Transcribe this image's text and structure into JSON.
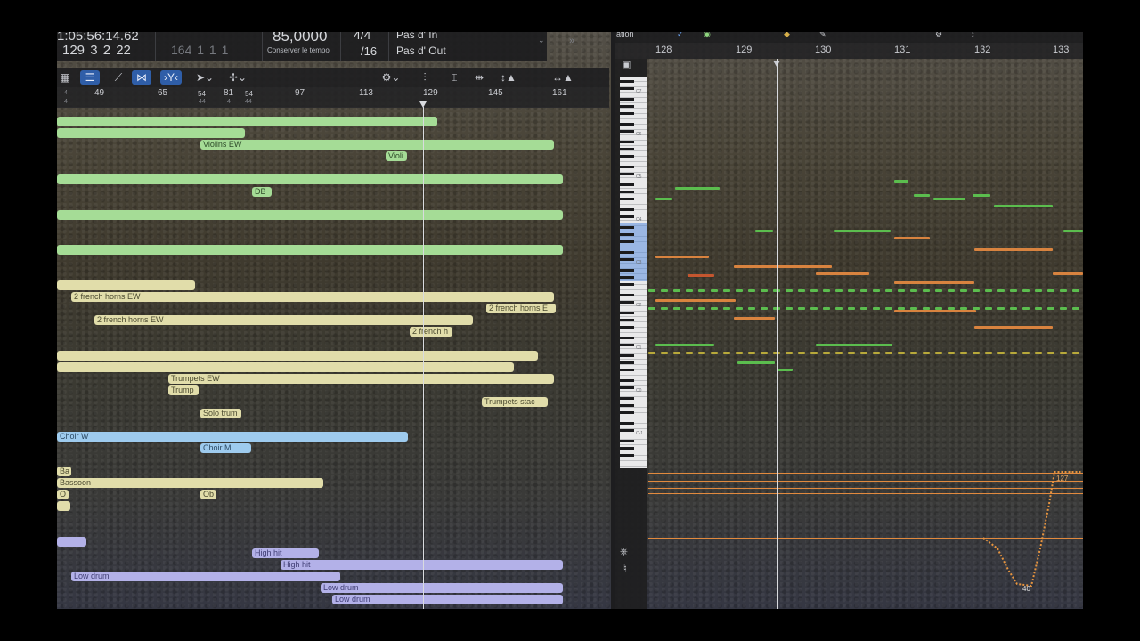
{
  "transport": {
    "time": "1:05:56:14.62",
    "position": "129  3  2    22",
    "end_position": "164  1  1    1",
    "tempo": "85,0000",
    "tempo_label": "Conserver le tempo",
    "signature": "4/4",
    "division": "/16",
    "punch_in": "Pas d' In",
    "punch_out": "Pas d' Out",
    "chevron": "»"
  },
  "left_ruler": {
    "bars": [
      "49",
      "65",
      "81",
      "97",
      "113",
      "129",
      "145",
      "161"
    ],
    "extra": [
      "54",
      "54"
    ],
    "small": [
      "4",
      "4",
      "44",
      "4",
      "44"
    ]
  },
  "regions": {
    "strings": [
      "Violins EW",
      "Violi",
      "DB"
    ],
    "horns": [
      "2 french horns EW",
      "2 french horns E",
      "2 french horns EW",
      "2 french h"
    ],
    "trumpets": [
      "Trumpets EW",
      "Trump",
      "Trumpets stac",
      "Solo trum"
    ],
    "choir": [
      "Choir W",
      "Choir M"
    ],
    "woodwinds": [
      "Ba",
      "Bassoon",
      "O",
      "Ob"
    ],
    "perc": [
      "High hit",
      "High hit",
      "Low drum",
      "Low drum",
      "Low drum"
    ]
  },
  "right_ruler": {
    "bars": [
      "128",
      "129",
      "130",
      "131",
      "132",
      "133"
    ],
    "label": "ation"
  },
  "piano": {
    "octaves": [
      "C7",
      "C6",
      "C5",
      "C4",
      "C3",
      "C2",
      "C1",
      "C0",
      "C-1"
    ]
  },
  "automation": {
    "max_value": "127",
    "min_value": "40"
  },
  "colors": {
    "strings": "#a5dc96",
    "brass": "#e1ddaa",
    "choir": "#9ecbee",
    "perc": "#b3b1e8",
    "note_green": "#5bbd4e",
    "note_orange": "#d8833f",
    "selection": "#2f5ea8"
  }
}
